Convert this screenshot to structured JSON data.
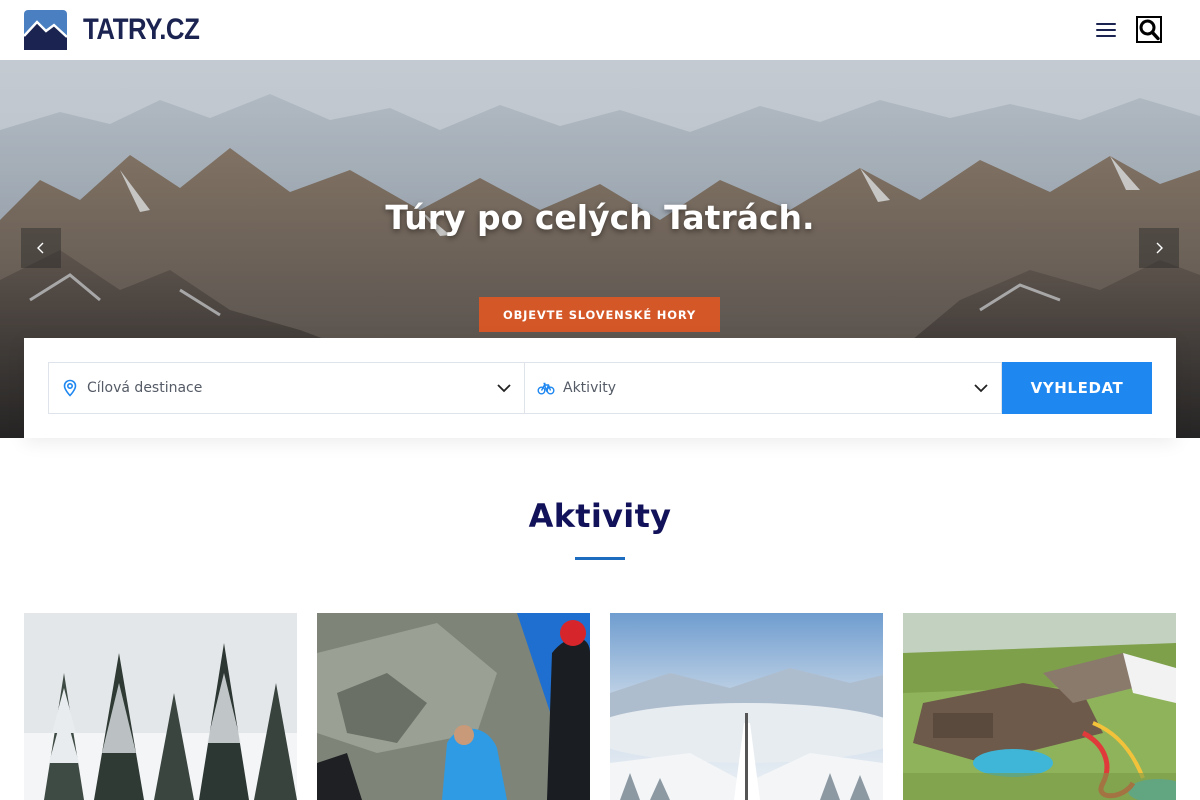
{
  "header": {
    "logo_text": "TATRY.CZ",
    "menu_icon": "hamburger-menu-icon",
    "search_icon": "search-icon"
  },
  "hero": {
    "title": "Túry po celých Tatrách.",
    "cta_label": "OBJEVTE SLOVENSKÉ HORY",
    "prev_icon": "chevron-left-icon",
    "next_icon": "chevron-right-icon"
  },
  "search": {
    "destination_placeholder": "Cílová destinace",
    "activity_placeholder": "Aktivity",
    "submit_label": "VYHLEDAT"
  },
  "section": {
    "title": "Aktivity"
  },
  "cards": [
    {
      "image": "snowy-spruce-forest"
    },
    {
      "image": "climbers-on-rock-ridge"
    },
    {
      "image": "winter-ski-resort-valley"
    },
    {
      "image": "aquapark-resort-aerial"
    }
  ],
  "colors": {
    "brand_navy": "#1b2350",
    "heading_navy": "#12125a",
    "cta_orange": "#d45728",
    "search_blue": "#1e87f0",
    "underline_blue": "#1e6cc0"
  }
}
